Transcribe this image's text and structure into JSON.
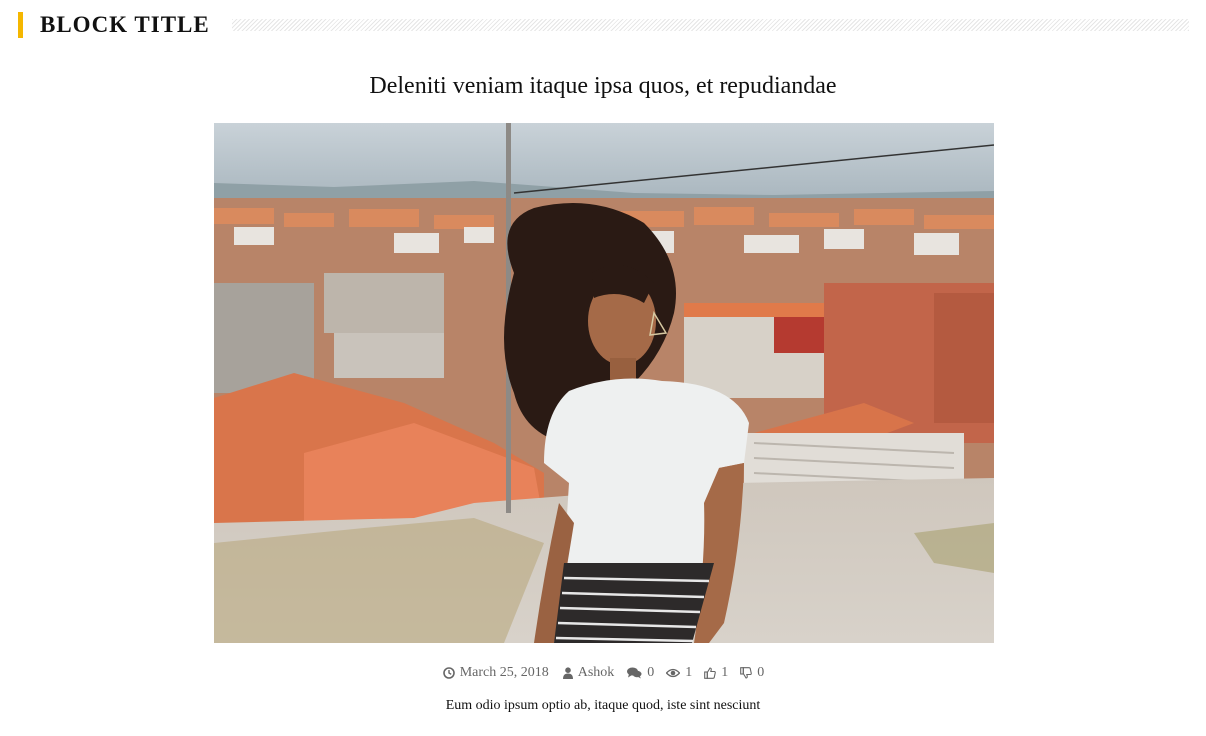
{
  "block": {
    "title": "BLOCK TITLE",
    "accent_color": "#f5b700"
  },
  "post": {
    "title": "Deleniti veniam itaque ipsa quos, et repudiandae",
    "image_alt": "Woman with curly hair standing above a hillside town of orange-roofed houses",
    "meta": {
      "date": "March 25, 2018",
      "author": "Ashok",
      "comments": "0",
      "views": "1",
      "likes": "1",
      "dislikes": "0"
    },
    "meta_icons": {
      "date": "clock-icon",
      "author": "user-icon",
      "comments": "comments-icon",
      "views": "eye-icon",
      "likes": "thumbs-up-icon",
      "dislikes": "thumbs-down-icon"
    },
    "excerpt": "Eum odio ipsum optio ab, itaque quod, iste sint nesciunt"
  }
}
